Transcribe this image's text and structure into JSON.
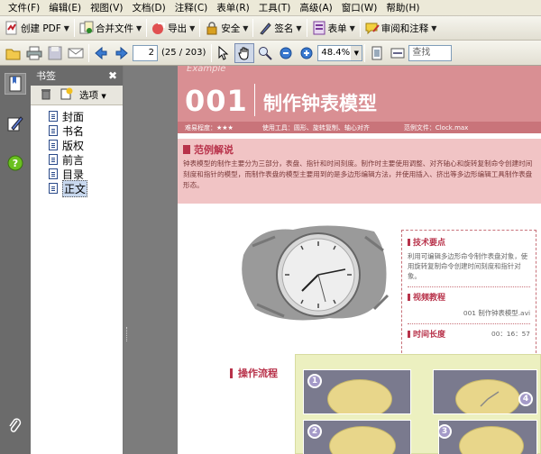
{
  "menubar": {
    "items": [
      "文件(F)",
      "编辑(E)",
      "视图(V)",
      "文档(D)",
      "注释(C)",
      "表单(R)",
      "工具(T)",
      "高级(A)",
      "窗口(W)",
      "帮助(H)"
    ]
  },
  "toolbar1": {
    "create_pdf": "创建 PDF",
    "combine": "合并文件",
    "export": "导出",
    "security": "安全",
    "sign": "签名",
    "forms": "表单",
    "review": "审阅和注释"
  },
  "toolbar2": {
    "page_number": "2",
    "page_count": "(25 / 203)",
    "zoom_value": "48.4%",
    "search_placeholder": "查找"
  },
  "bookmarks": {
    "title": "书签",
    "options_label": "选项",
    "items": [
      "封面",
      "书名",
      "版权",
      "前言",
      "目录",
      "正文"
    ]
  },
  "document": {
    "example_label": "Example",
    "example_number": "001",
    "example_title": "制作钟表模型",
    "meta": {
      "difficulty": "难易程度：★★★",
      "tools": "使用工具：圆形、旋转复制、轴心对齐",
      "example_file": "范例文件：Clock.max"
    },
    "analysis_heading": "范例解说",
    "analysis_text": "钟表模型的制作主要分为三部分，表盘、指针和时间刻度。制作时主要使用调整、对齐轴心和旋转复制命令创建时间刻度和指针的模型，而制作表盘的模型主要用到的是多边形编辑方法，并使用插入、挤出等多边形编辑工具制作表盘形态。",
    "tech_heading": "技术要点",
    "tech_text": "利用可编辑多边形命令制作表盘对象，使用旋转复制命令创建时间刻度和指针对象。",
    "video_heading": "视频教程",
    "video_text": "001 制作钟表模型.avi",
    "duration_heading": "时间长度",
    "duration_text": "00：16：57",
    "flow_heading": "操作流程",
    "flow_steps": [
      "1",
      "2",
      "3",
      "4"
    ]
  },
  "colors": {
    "accent": "#b8324a",
    "banner": "#d98f93",
    "analysis_bg": "#f1c4c5",
    "flow_bg": "#ecf0c0"
  }
}
